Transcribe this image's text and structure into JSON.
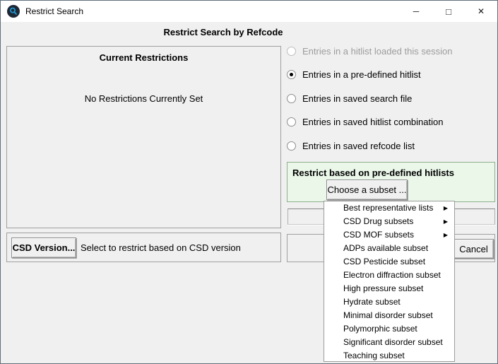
{
  "window": {
    "title": "Restrict Search",
    "controls": {
      "minimize": "─",
      "maximize": "□",
      "close": "✕"
    }
  },
  "heading": "Restrict Search by Refcode",
  "current_restrictions": {
    "title": "Current Restrictions",
    "empty_message": "No Restrictions Currently Set"
  },
  "radio_options": [
    {
      "label": "Entries in a hitlist loaded this session",
      "selected": false,
      "disabled": true
    },
    {
      "label": "Entries in a pre-defined hitlist",
      "selected": true,
      "disabled": false
    },
    {
      "label": "Entries in saved search file",
      "selected": false,
      "disabled": false
    },
    {
      "label": "Entries in saved hitlist combination",
      "selected": false,
      "disabled": false
    },
    {
      "label": "Entries in saved refcode list",
      "selected": false,
      "disabled": false
    }
  ],
  "predefined_panel": {
    "title": "Restrict based on pre-defined hitlists",
    "button_label": "Choose a subset ...",
    "bg_color": "#eaf7e9",
    "border_color": "#8fae8f"
  },
  "subset_menu": {
    "submenu_arrow": "▶",
    "items": [
      {
        "label": "Best representative lists",
        "has_submenu": true
      },
      {
        "label": "CSD Drug subsets",
        "has_submenu": true
      },
      {
        "label": "CSD MOF subsets",
        "has_submenu": true
      },
      {
        "label": "ADPs available subset",
        "has_submenu": false
      },
      {
        "label": "CSD Pesticide subset",
        "has_submenu": false
      },
      {
        "label": "Electron diffraction subset",
        "has_submenu": false
      },
      {
        "label": "High pressure subset",
        "has_submenu": false
      },
      {
        "label": "Hydrate subset",
        "has_submenu": false
      },
      {
        "label": "Minimal disorder subset",
        "has_submenu": false
      },
      {
        "label": "Polymorphic subset",
        "has_submenu": false
      },
      {
        "label": "Significant disorder subset",
        "has_submenu": false
      },
      {
        "label": "Teaching subset",
        "has_submenu": false
      }
    ]
  },
  "csd_version": {
    "button_label": "CSD Version...",
    "description": "Select to restrict based on CSD version"
  },
  "actions": {
    "cancel_label": "Cancel"
  },
  "colors": {
    "dialog_bg": "#f0f0f0",
    "titlebar_bg": "#ffffff",
    "icon_blue": "#1d9bd8",
    "menu_bg": "#ffffff"
  }
}
